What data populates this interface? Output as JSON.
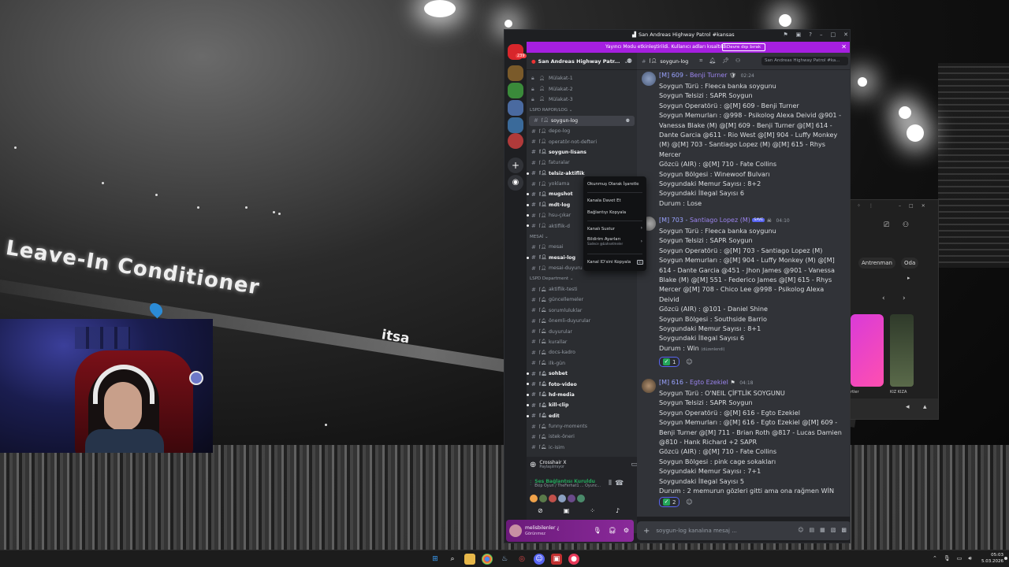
{
  "window": {
    "title": "San Andreas Highway Patrol #kansas",
    "streamer_bar": {
      "text": "Yayıncı Modu etkinleştirildi. Kullanıcı adları kısaltıldı.",
      "button": "Devre dışı bırak"
    }
  },
  "background": {
    "banner_text": "Leave-In Conditioner",
    "banner_text_2": "itsa"
  },
  "guilds": {
    "badge": "239"
  },
  "server": {
    "name": "San Andreas Highway Patr...",
    "channels_top": [
      {
        "name": "Mülakat-1"
      },
      {
        "name": "Mülakat-2"
      },
      {
        "name": "Mülakat-3"
      }
    ],
    "category_rapor": "LSPD RAPOR/LOG",
    "channels_rapor": [
      {
        "name": "soygun-log",
        "state": "active"
      },
      {
        "name": "depo-log",
        "state": "muted"
      },
      {
        "name": "operatör-not-defteri",
        "state": "muted"
      },
      {
        "name": "soygun-lisans",
        "state": "unread"
      },
      {
        "name": "faturalar",
        "state": "muted"
      },
      {
        "name": "telsiz-aktiflik",
        "state": "unread"
      },
      {
        "name": "yoklama",
        "state": "muted"
      },
      {
        "name": "mugshot",
        "state": "unread"
      },
      {
        "name": "mdt-log",
        "state": "unread"
      },
      {
        "name": "hsu-çıkar",
        "state": "muted"
      },
      {
        "name": "aktiflik-d",
        "state": "muted"
      }
    ],
    "category_mesai": "MESAİ",
    "channels_mesai": [
      {
        "name": "mesai",
        "state": "muted"
      },
      {
        "name": "mesai-log",
        "state": "unread"
      },
      {
        "name": "mesai-duyuru",
        "state": "muted"
      }
    ],
    "category_department": "LSPD Department",
    "channels_department": [
      {
        "name": "aktiflik-testi",
        "state": "muted"
      },
      {
        "name": "güncellemeler",
        "state": "muted"
      },
      {
        "name": "sorumluluklar",
        "state": "muted"
      },
      {
        "name": "önemli-duyurular",
        "state": "muted"
      },
      {
        "name": "duyurular",
        "state": "muted"
      },
      {
        "name": "kurallar",
        "state": "muted"
      },
      {
        "name": "docs-kadro",
        "state": "muted"
      },
      {
        "name": "ilk-gün",
        "state": "muted"
      },
      {
        "name": "sohbet",
        "state": "unread"
      },
      {
        "name": "foto-video",
        "state": "unread"
      },
      {
        "name": "hd-media",
        "state": "unread"
      },
      {
        "name": "kill-clip",
        "state": "unread"
      },
      {
        "name": "edit",
        "state": "unread"
      },
      {
        "name": "funny-moments",
        "state": "muted"
      },
      {
        "name": "istek-öneri",
        "state": "muted"
      },
      {
        "name": "ic-isim",
        "state": "muted"
      }
    ]
  },
  "activity": {
    "title": "Crosshair X",
    "subtitle": "Paylaşılmıyor"
  },
  "voice": {
    "status": "Ses Bağlantısı Kuruldu",
    "channel": "Ekip Oyun / TheFerhat1 ... Oyunc..."
  },
  "user": {
    "name": "melisbilenler ¿",
    "status": "Görünmez"
  },
  "chat": {
    "channel": "soygun-log",
    "search_placeholder": "San Andreas Highway Patrol #ka...",
    "composer_placeholder": "soygun-log kanalına mesaj ...",
    "messages": [
      {
        "author_prefix": "[M] 609 -",
        "author_name": "Benji Turner",
        "time": "02:24",
        "lines": [
          "Soygun Türü : Fleeca banka soygunu",
          "Soygun Telsizi : SAPR Soygun",
          "Soygun Operatörü : @[M] 609 - Benji Turner",
          "Soygun Memurları : @998 - Psikolog Alexa Deivid @901 -",
          "Vanessa Blake (M) @[M] 609 - Benji Turner @[M] 614 -",
          "Dante Garcia @611 - Rio West @[M] 904 - Luffy Monkey",
          "(M) @[M] 703 - Santiago Lopez (M) @[M] 615 - Rhys",
          "Mercer",
          "Gözcü (AIR) : @[M] 710 - Fate Collins",
          "Soygun Bölgesi : Winewoof Bulvarı",
          "Soygundaki Memur Sayısı : 8+2",
          "Soygundaki İllegal Sayısı 6",
          "Durum : Lose"
        ]
      },
      {
        "author_prefix": "[M] 703 -",
        "author_name": "Santiago Lopez (M)",
        "time": "04:10",
        "lines": [
          "Soygun Türü : Fleeca banka soygunu",
          "Soygun Telsizi : SAPR Soygun",
          "Soygun Operatörü : @[M] 703 - Santiago Lopez (M)",
          "Soygun Memurları : @[M] 904 - Luffy Monkey (M) @[M]",
          "614 - Dante Garcia @451 - Jhon James @901 - Vanessa",
          "Blake (M) @[M] 551 - Federico James @[M] 615 - Rhys",
          "Mercer @[M] 708 - Chico Lee @998 - Psikolog Alexa",
          "Deivid",
          "Gözcü (AIR) : @101 - Daniel Shine",
          "Soygun Bölgesi : Southside Barrio",
          "Soygundaki Memur Sayısı : 8+1",
          "Soygundaki İllegal Sayısı 6",
          "Durum : Win"
        ],
        "edited": "(düzenlendi)",
        "reaction_count": "1"
      },
      {
        "author_prefix": "[M] 616 -",
        "author_name": "Egto Ezekiel",
        "time": "04:18",
        "lines": [
          "Soygun Türü : O'NEIL ÇİFTLİK SOYGUNU",
          "Soygun Telsizi : SAPR Soygun",
          "Soygun Operatörü : @[M] 616 - Egto Ezekiel",
          "Soygun Memurları : @[M] 616 - Egto Ezekiel @[M] 609 -",
          "Benji Turner @[M] 711 - Brian Roth @817 - Lucas Damien",
          "@810 - Hank Richard +2 SAPR",
          "Gözcü (AIR) : @[M] 710 - Fate Collins",
          "Soygun Bölgesi : pink cage sokakları",
          "Soygundaki Memur Sayısı : 7+1",
          "Soygundaki İllegal Sayısı 5",
          "Durum : 2 memurun gözleri gitti ama ona rağmen WİN"
        ],
        "reaction_count": "2"
      }
    ],
    "save_badge": "SAVE"
  },
  "context_menu": {
    "mark_read": "Okunmuş Olarak İşaretle",
    "invite": "Kanala Davet Et",
    "copy_link": "Bağlantıyı Kopyala",
    "mute": "Kanalı Sustur",
    "notifications": "Bildirim Ayarları",
    "notifications_sub": "Sadece @bahsetmeler",
    "copy_id": "Kanal ID'sini Kopyala",
    "id_badge": "ID"
  },
  "side_window": {
    "tab_1": "Antrenman",
    "tab_2": "Oda",
    "caption_1": "rtler",
    "caption_2": "KIZ KIZA"
  },
  "taskbar": {
    "time": "05:03",
    "date": "5.03.2026"
  },
  "colors": {
    "accent": "#a51fe0",
    "mention": "#5865f2",
    "online": "#23a55a"
  }
}
